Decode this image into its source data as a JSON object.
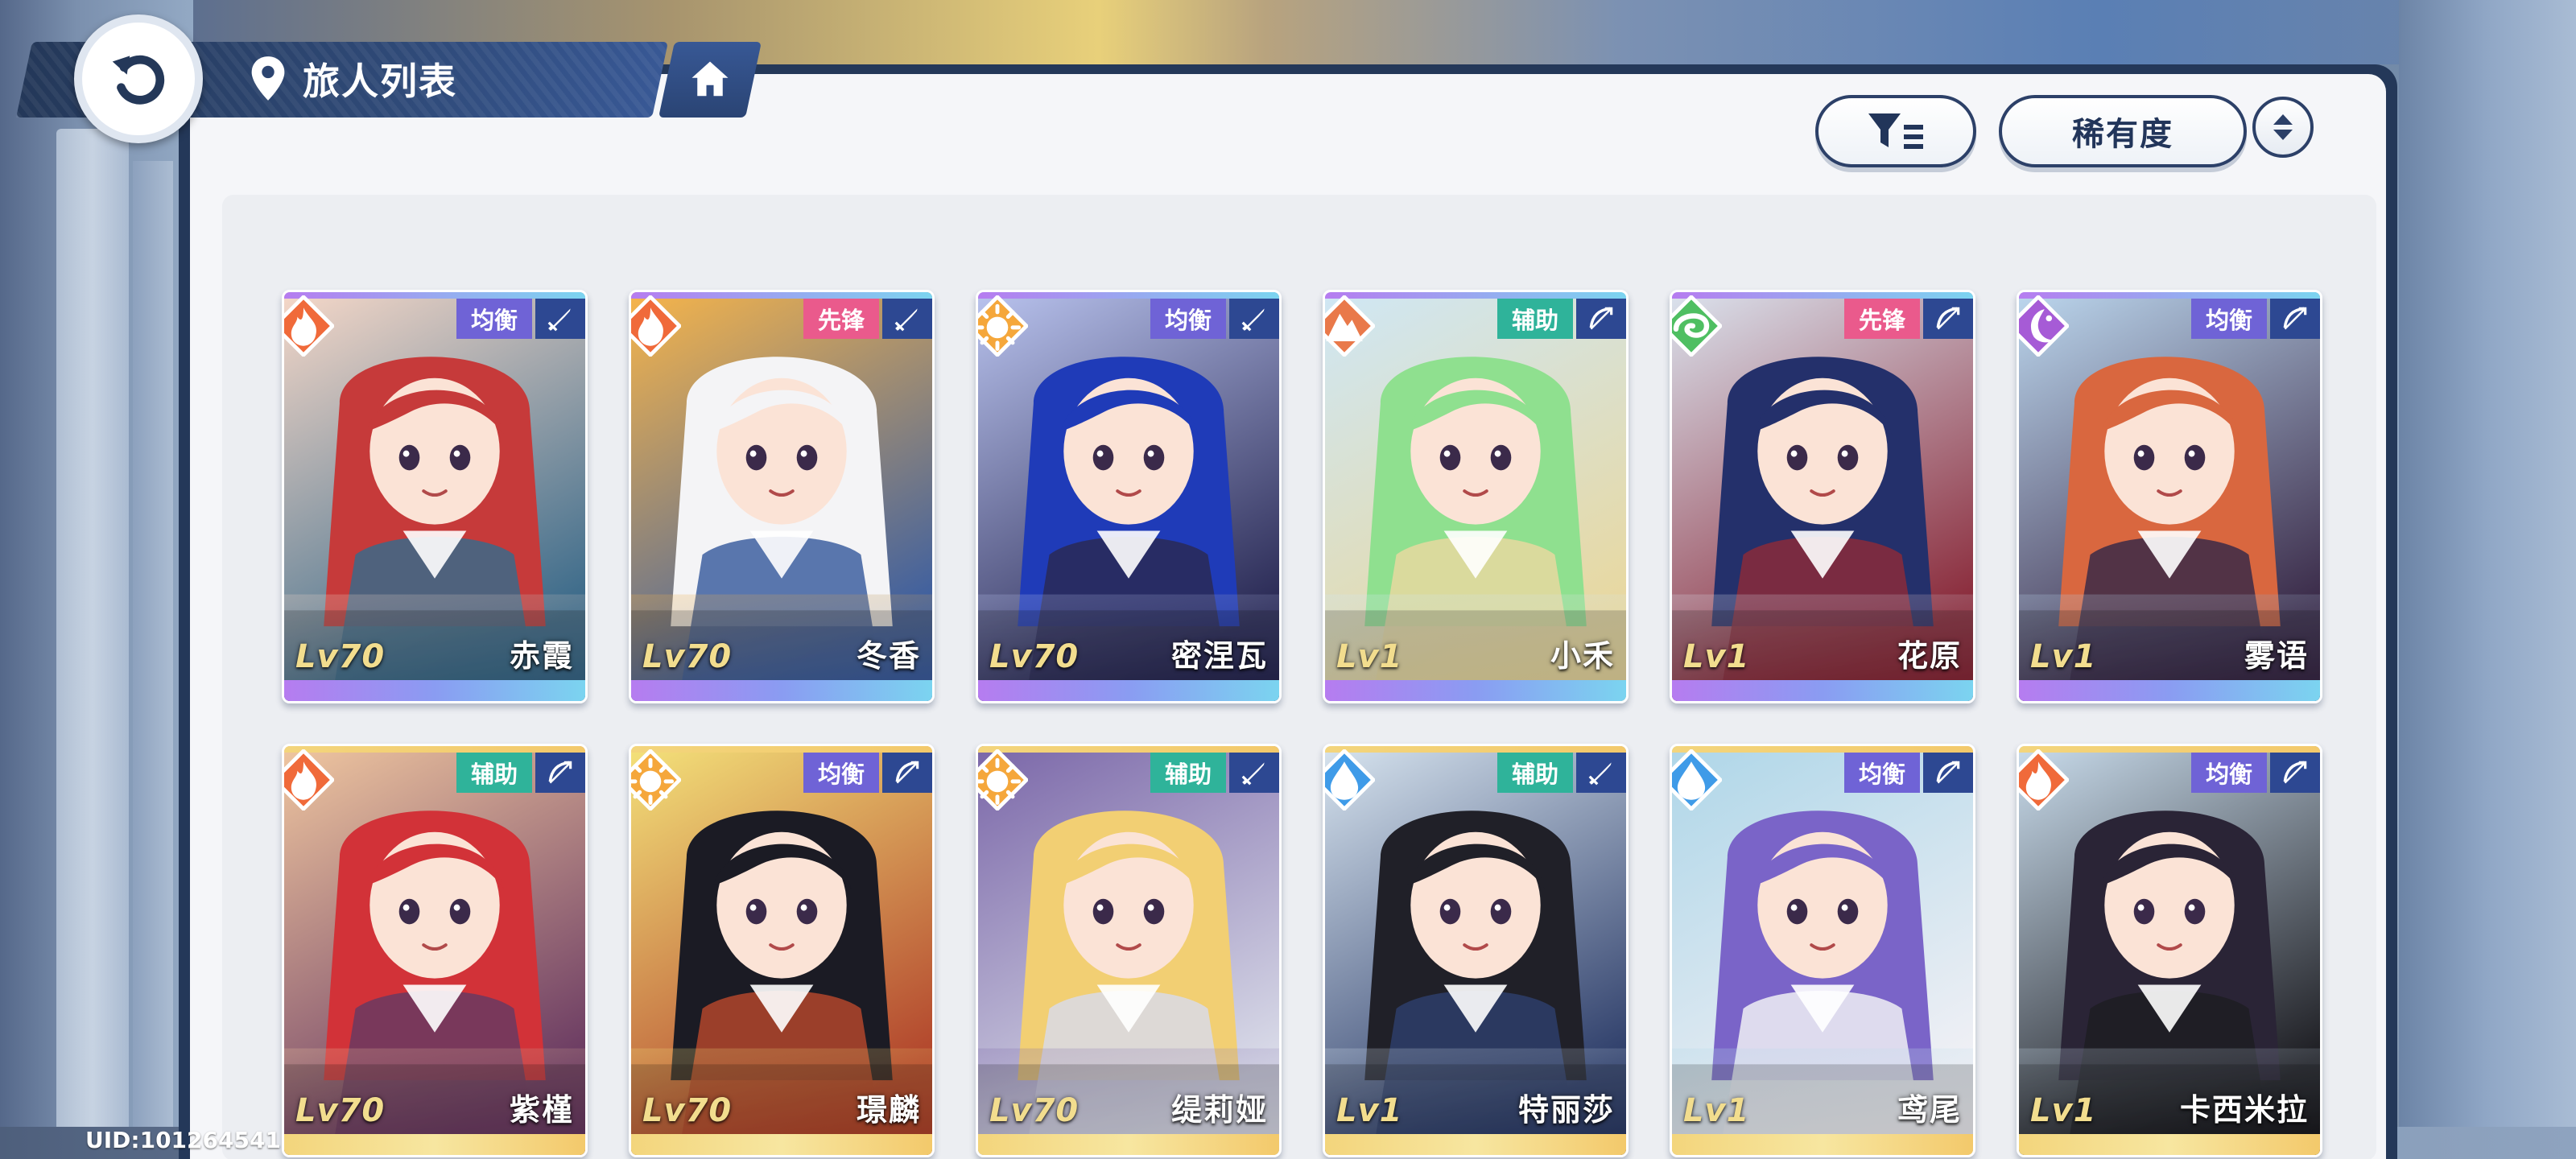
{
  "header": {
    "title": "旅人列表"
  },
  "controls": {
    "sort_label": "稀有度"
  },
  "uid": "UID:101264541",
  "colors": {
    "role_balance": "#6f63d6",
    "role_vanguard": "#ea5a8c",
    "role_support": "#2fb39a",
    "weapon_bg": "#2d4892",
    "fire": "#f06a3a",
    "light": "#f5a73b",
    "earth": "#e9794a",
    "wind": "#4fbf62",
    "dark": "#a65bd6",
    "water": "#3f9be8"
  },
  "cards": [
    {
      "name": "赤霞",
      "level": "Lv70",
      "role": "均衡",
      "element": "fire",
      "weapon": "sword",
      "frame": "purple",
      "hair": "#c63a3a",
      "bg1": "#f6d8c8",
      "bg2": "#3a6a8a"
    },
    {
      "name": "冬香",
      "level": "Lv70",
      "role": "先锋",
      "element": "fire",
      "weapon": "sword",
      "frame": "purple",
      "hair": "#f4f4f6",
      "bg1": "#f7b54a",
      "bg2": "#3d5fa0"
    },
    {
      "name": "密涅瓦",
      "level": "Lv70",
      "role": "均衡",
      "element": "light",
      "weapon": "sword",
      "frame": "purple",
      "hair": "#1f3bb8",
      "bg1": "#b9c3ee",
      "bg2": "#2a2a55"
    },
    {
      "name": "小禾",
      "level": "Lv1",
      "role": "辅助",
      "element": "earth",
      "weapon": "bow",
      "frame": "purple",
      "hair": "#8fe08f",
      "bg1": "#cfe7f5",
      "bg2": "#e8d8a0"
    },
    {
      "name": "花原",
      "level": "Lv1",
      "role": "先锋",
      "element": "wind",
      "weapon": "bow",
      "frame": "purple",
      "hair": "#24306b",
      "bg1": "#dbe3ee",
      "bg2": "#8a2a3a"
    },
    {
      "name": "雾语",
      "level": "Lv1",
      "role": "均衡",
      "element": "dark",
      "weapon": "bow",
      "frame": "purple",
      "hair": "#d9673f",
      "bg1": "#bcd7ee",
      "bg2": "#3a2a48"
    },
    {
      "name": "紫槿",
      "level": "Lv70",
      "role": "辅助",
      "element": "fire",
      "weapon": "bow",
      "frame": "gold",
      "hair": "#d23238",
      "bg1": "#f0c7a0",
      "bg2": "#6a3a62"
    },
    {
      "name": "璟麟",
      "level": "Lv70",
      "role": "均衡",
      "element": "light",
      "weapon": "bow",
      "frame": "gold",
      "hair": "#1b1b24",
      "bg1": "#f4e27a",
      "bg2": "#b2452c"
    },
    {
      "name": "缇莉娅",
      "level": "Lv70",
      "role": "辅助",
      "element": "light",
      "weapon": "sword",
      "frame": "gold",
      "hair": "#f2cf73",
      "bg1": "#7a66a8",
      "bg2": "#d9dbe8"
    },
    {
      "name": "特丽莎",
      "level": "Lv1",
      "role": "辅助",
      "element": "water",
      "weapon": "sword",
      "frame": "gold",
      "hair": "#202028",
      "bg1": "#d7e4ef",
      "bg2": "#2e3e6a"
    },
    {
      "name": "鸢尾",
      "level": "Lv1",
      "role": "均衡",
      "element": "water",
      "weapon": "bow",
      "frame": "gold",
      "hair": "#7a64c8",
      "bg1": "#aed6e8",
      "bg2": "#f0f0f5"
    },
    {
      "name": "卡西米拉",
      "level": "Lv1",
      "role": "均衡",
      "element": "fire",
      "weapon": "bow",
      "frame": "gold",
      "hair": "#2a2436",
      "bg1": "#c9dcec",
      "bg2": "#1d1d22"
    }
  ]
}
